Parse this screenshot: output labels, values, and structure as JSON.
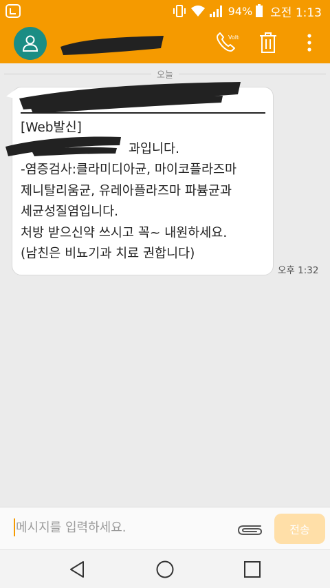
{
  "status_bar": {
    "battery_percent_text": "94%",
    "time": "오전 1:13",
    "app_icon": "lg-notification-icon",
    "icons": [
      "vibrate-icon",
      "wifi-icon",
      "signal-icon",
      "battery-icon"
    ]
  },
  "app_bar": {
    "avatar_icon": "person-icon",
    "contact_name": "",
    "actions": [
      {
        "name": "volte-call-icon",
        "badge": "Volte"
      },
      {
        "name": "trash-icon"
      },
      {
        "name": "overflow-menu-icon"
      }
    ]
  },
  "thread": {
    "date_label": "오늘",
    "message": {
      "subject": "",
      "lines": [
        "[Web발신]",
        "과입니다.",
        "-염증검사:클라미디아균, 마이코플라즈마",
        "제니탈리움균, 유레아플라즈마 파븀균과",
        "세균성질염입니다.",
        "처방 받으신약 쓰시고 꼭~ 내원하세요.",
        "(남친은 비뇨기과 치료 권합니다)"
      ],
      "timestamp": "오후 1:32"
    }
  },
  "composer": {
    "placeholder": "메시지를 입력하세요.",
    "attach_icon": "paperclip-icon",
    "send_label": "전송"
  },
  "nav_bar": {
    "buttons": [
      "back-icon",
      "home-icon",
      "recents-icon"
    ]
  },
  "colors": {
    "accent": "#f59a00",
    "avatar": "#1b8d84",
    "send_disabled": "#ffdfa8",
    "background": "#ebebeb"
  }
}
